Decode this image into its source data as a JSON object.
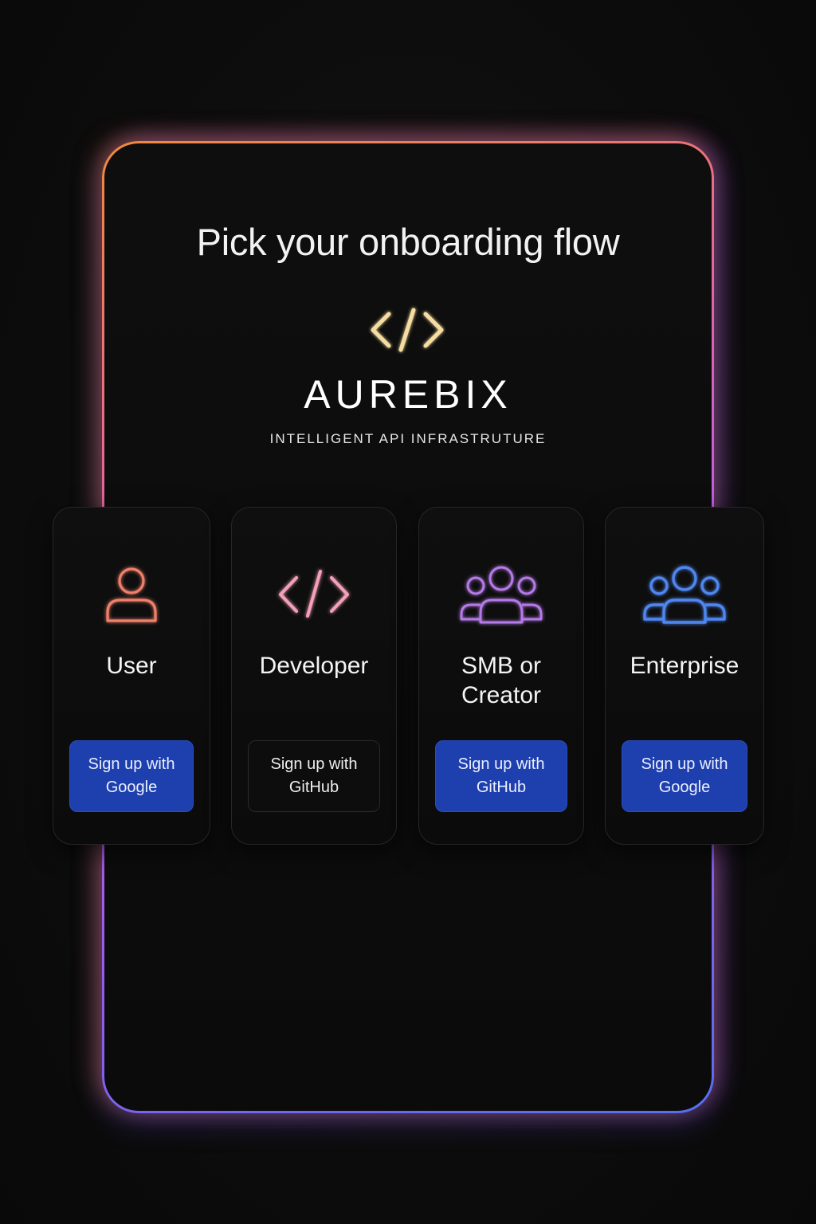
{
  "title": "Pick your onboarding flow",
  "brand": {
    "logo_icon": "code-brackets-icon",
    "name": "AUREBIX",
    "tagline": "INTELLIGENT API INFRASTRUTURE"
  },
  "colors": {
    "frame_gradient": [
      "#f08a3c",
      "#ea6a8c",
      "#c05ce8",
      "#8f5cf0",
      "#5570ef"
    ],
    "button_blue": "#1e3fae",
    "logo_icon": "#f5dca0"
  },
  "cards": [
    {
      "id": "user",
      "icon": "user-icon",
      "icon_color": "#f0806a",
      "label_lines": [
        "User"
      ],
      "button": {
        "lines": [
          "Sign up with",
          "Google"
        ],
        "style": "blue"
      }
    },
    {
      "id": "developer",
      "icon": "code-icon",
      "icon_color": "#f3a0b8",
      "label_lines": [
        "Developer"
      ],
      "button": {
        "lines": [
          "Sign up with",
          "GitHub"
        ],
        "style": "dark"
      }
    },
    {
      "id": "smb-creator",
      "icon": "group-icon",
      "icon_color": "#b57ae8",
      "label_lines": [
        "SMB or",
        "Creator"
      ],
      "button": {
        "lines": [
          "Sign up with",
          "GitHub"
        ],
        "style": "blue"
      }
    },
    {
      "id": "enterprise",
      "icon": "group-icon",
      "icon_color": "#4f86f0",
      "label_lines": [
        "Enterprise"
      ],
      "button": {
        "lines": [
          "Sign up with",
          "Google"
        ],
        "style": "blue"
      }
    }
  ]
}
